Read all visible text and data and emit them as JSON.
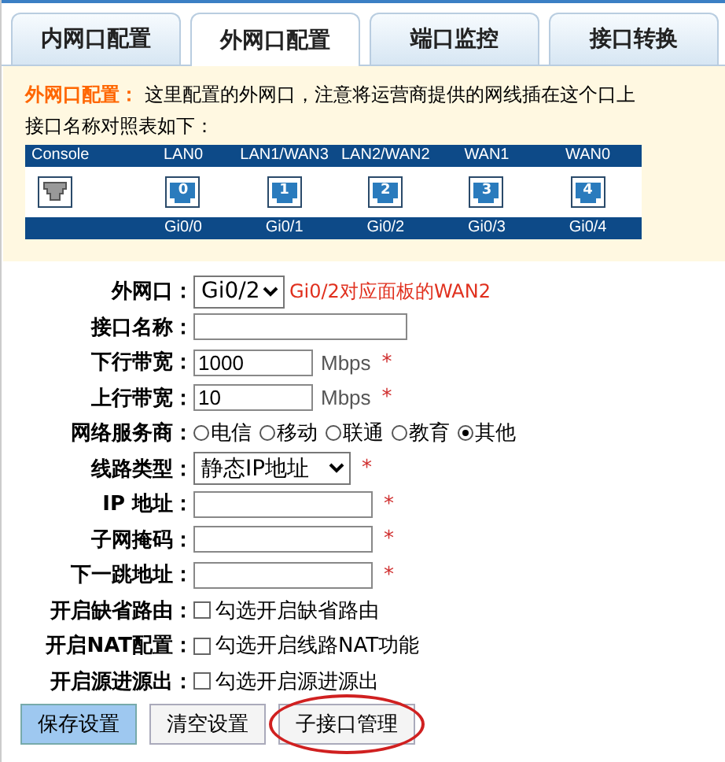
{
  "tabs": [
    {
      "label": "内网口配置",
      "selected": false
    },
    {
      "label": "外网口配置",
      "selected": true
    },
    {
      "label": "端口监控",
      "selected": false
    },
    {
      "label": "接口转换",
      "selected": false
    }
  ],
  "notice": {
    "title": "外网口配置：",
    "text": "这里配置的外网口，注意将运营商提供的网线插在这个口上",
    "subtitle": "接口名称对照表如下："
  },
  "ports": [
    {
      "kind": "console",
      "label": "Console"
    },
    {
      "kind": "eth",
      "label": "LAN0",
      "number": "0",
      "interface": "Gi0/0"
    },
    {
      "kind": "eth",
      "label": "LAN1/WAN3",
      "number": "1",
      "interface": "Gi0/1"
    },
    {
      "kind": "eth",
      "label": "LAN2/WAN2",
      "number": "2",
      "interface": "Gi0/2"
    },
    {
      "kind": "eth",
      "label": "WAN1",
      "number": "3",
      "interface": "Gi0/3"
    },
    {
      "kind": "eth",
      "label": "WAN0",
      "number": "4",
      "interface": "Gi0/4"
    }
  ],
  "form": [
    {
      "kind": "select",
      "label": "外网口：",
      "value": "Gi0/2",
      "hint": "Gi0/2对应面板的WAN2"
    },
    {
      "kind": "text",
      "label": "接口名称："
    },
    {
      "kind": "text",
      "label": "下行带宽：",
      "value": "1000",
      "unit": "Mbps",
      "required_mark": "*"
    },
    {
      "kind": "text",
      "label": "上行带宽：",
      "value": "10",
      "unit": "Mbps",
      "required_mark": "*"
    },
    {
      "kind": "radio",
      "label": "网络服务商：",
      "options": [
        {
          "label": "电信",
          "selected": false
        },
        {
          "label": "移动",
          "selected": false
        },
        {
          "label": "联通",
          "selected": false
        },
        {
          "label": "教育",
          "selected": false
        },
        {
          "label": "其他",
          "selected": true
        }
      ]
    },
    {
      "kind": "select",
      "label": "线路类型：",
      "value": "静态IP地址",
      "required_mark": "*"
    },
    {
      "kind": "text",
      "label": "IP 地址：",
      "required_mark": "*"
    },
    {
      "kind": "text",
      "label": "子网掩码：",
      "required_mark": "*"
    },
    {
      "kind": "text",
      "label": "下一跳地址：",
      "required_mark": "*"
    },
    {
      "kind": "checkbox",
      "label": "开启缺省路由：",
      "text": "勾选开启缺省路由",
      "checked": false
    },
    {
      "kind": "checkbox",
      "label": "开启NAT配置：",
      "text": "勾选开启线路NAT功能",
      "checked": false
    },
    {
      "kind": "checkbox",
      "label": "开启源进源出：",
      "text": "勾选开启源进源出",
      "checked": false
    }
  ],
  "buttons": [
    {
      "label": "保存设置",
      "primary": true,
      "circled": false
    },
    {
      "label": "清空设置",
      "primary": false,
      "circled": false
    },
    {
      "label": "子接口管理",
      "primary": false,
      "circled": true
    }
  ]
}
